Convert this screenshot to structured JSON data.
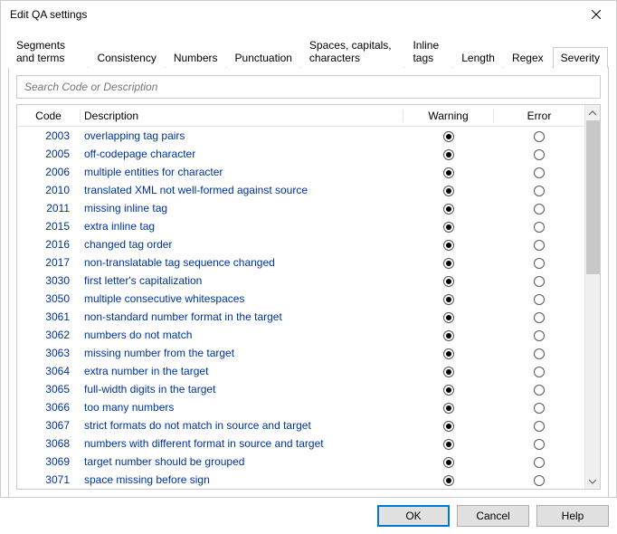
{
  "window": {
    "title": "Edit QA settings"
  },
  "tabs": [
    {
      "label": "Segments and terms"
    },
    {
      "label": "Consistency"
    },
    {
      "label": "Numbers"
    },
    {
      "label": "Punctuation"
    },
    {
      "label": "Spaces, capitals, characters"
    },
    {
      "label": "Inline tags"
    },
    {
      "label": "Length"
    },
    {
      "label": "Regex"
    },
    {
      "label": "Severity"
    }
  ],
  "active_tab_index": 8,
  "search": {
    "placeholder": "Search Code or Description",
    "value": ""
  },
  "columns": {
    "code": "Code",
    "description": "Description",
    "warning": "Warning",
    "error": "Error"
  },
  "rows": [
    {
      "code": "2003",
      "description": "overlapping tag pairs",
      "severity": "warning"
    },
    {
      "code": "2005",
      "description": "off-codepage character",
      "severity": "warning"
    },
    {
      "code": "2006",
      "description": "multiple entities for character",
      "severity": "warning"
    },
    {
      "code": "2010",
      "description": "translated XML not well-formed against source",
      "severity": "warning"
    },
    {
      "code": "2011",
      "description": "missing inline tag",
      "severity": "warning"
    },
    {
      "code": "2015",
      "description": "extra inline tag",
      "severity": "warning"
    },
    {
      "code": "2016",
      "description": "changed tag order",
      "severity": "warning"
    },
    {
      "code": "2017",
      "description": "non-translatable tag sequence changed",
      "severity": "warning"
    },
    {
      "code": "3030",
      "description": "first letter's capitalization",
      "severity": "warning"
    },
    {
      "code": "3050",
      "description": "multiple consecutive whitespaces",
      "severity": "warning"
    },
    {
      "code": "3061",
      "description": "non-standard number format in the target",
      "severity": "warning"
    },
    {
      "code": "3062",
      "description": "numbers do not match",
      "severity": "warning"
    },
    {
      "code": "3063",
      "description": "missing number from the target",
      "severity": "warning"
    },
    {
      "code": "3064",
      "description": "extra number in the target",
      "severity": "warning"
    },
    {
      "code": "3065",
      "description": "full-width digits in the target",
      "severity": "warning"
    },
    {
      "code": "3066",
      "description": "too many numbers",
      "severity": "warning"
    },
    {
      "code": "3067",
      "description": "strict formats do not match in source and target",
      "severity": "warning"
    },
    {
      "code": "3068",
      "description": "numbers with different format in source and target",
      "severity": "warning"
    },
    {
      "code": "3069",
      "description": "target number should be grouped",
      "severity": "warning"
    },
    {
      "code": "3071",
      "description": "space missing before sign",
      "severity": "warning"
    }
  ],
  "buttons": {
    "ok": "OK",
    "cancel": "Cancel",
    "help": "Help"
  }
}
